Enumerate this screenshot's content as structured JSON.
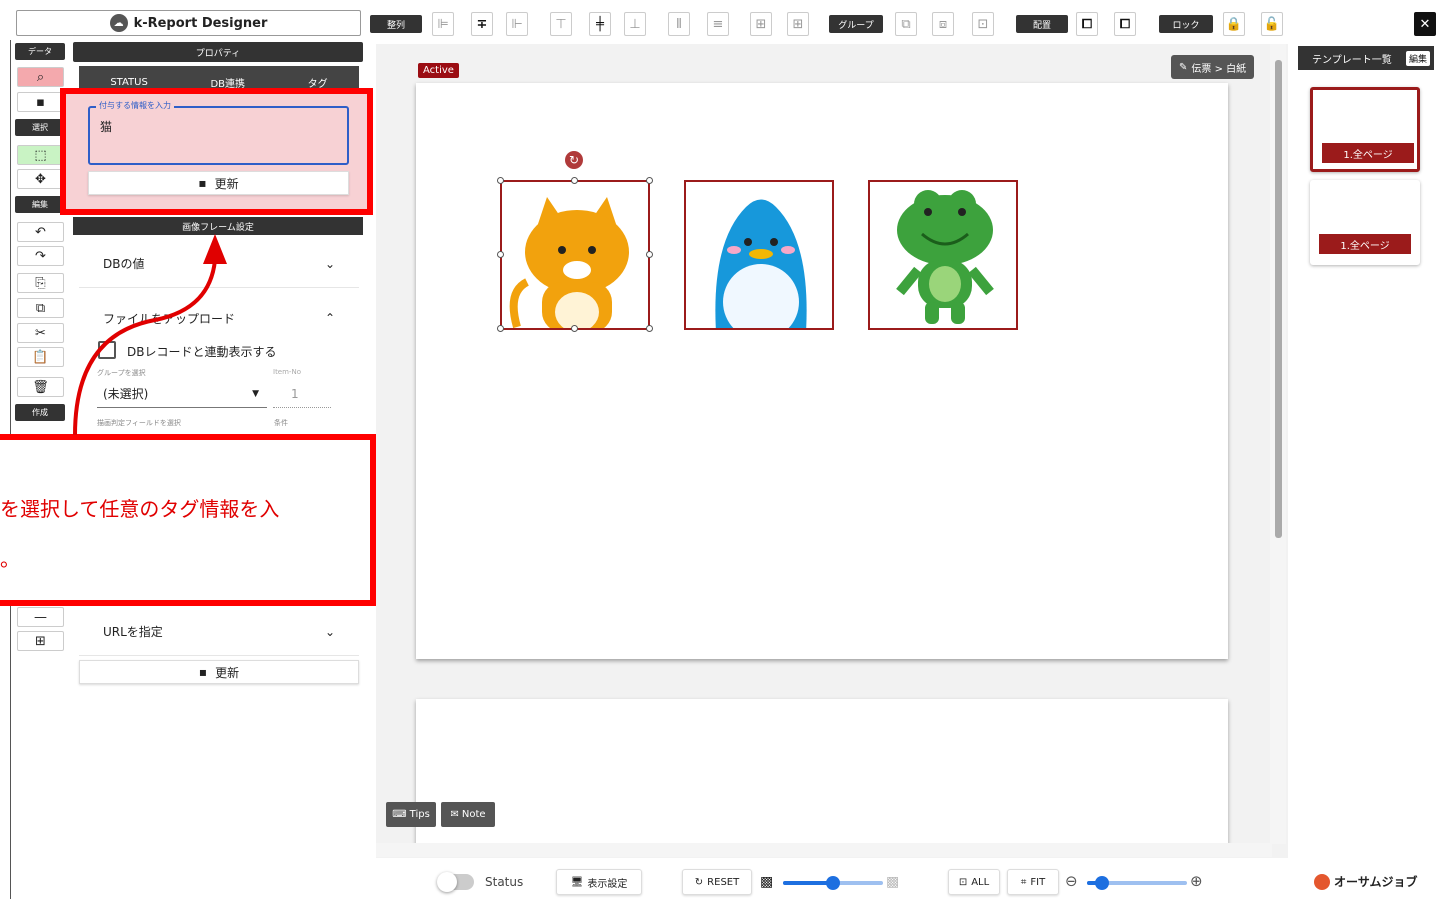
{
  "app": {
    "title": "k-Report Designer",
    "logo_icon": "cloud-icon"
  },
  "toolbar": {
    "align_label": "整列",
    "group_label": "グループ",
    "arrange_label": "配置",
    "lock_label": "ロック"
  },
  "left_sidebar": {
    "data_label": "データ",
    "select_label": "選択",
    "edit_label": "編集",
    "create_label": "作成"
  },
  "properties": {
    "title": "プロパティ",
    "tabs": [
      "STATUS",
      "DB連携",
      "タグ"
    ],
    "tag_field_label": "付与する情報を入力",
    "tag_value": "猫",
    "update_label": "更新",
    "frame_section_title": "画像フレーム設定",
    "db_value_label": "DBの値",
    "upload_label": "ファイルをアップロード",
    "link_checkbox_label": "DBレコードと連動表示する",
    "group_select_caption": "グループを選択",
    "group_select_value": "(未選択)",
    "item_no_caption": "Item-No",
    "item_no_value": "1",
    "field_caption": "描画判定フィールドを選択",
    "condition_caption": "条件",
    "url_label": "URLを指定"
  },
  "callout": {
    "line1": "を選択して任意のタグ情報を入",
    "line2": "。"
  },
  "canvas": {
    "active_badge": "Active",
    "breadcrumb": "伝票 > 白紙",
    "images": [
      "cat",
      "penguin",
      "frog"
    ]
  },
  "templates": {
    "title": "テンプレート一覧",
    "edit_label": "編集",
    "items": [
      "1.全ページ",
      "1.全ページ"
    ]
  },
  "bottom_bar": {
    "status_label": "Status",
    "display_settings_label": "表示設定",
    "reset_label": "RESET",
    "all_label": "ALL",
    "fit_label": "FIT",
    "opacity_level": 0.5,
    "zoom_level": 0.15
  },
  "brand": {
    "name": "オーサムジョブ"
  },
  "colors": {
    "accent": "#9b1b1b",
    "highlight": "#ff0000",
    "callout_text": "#e00000",
    "focus": "#2f5ec8"
  }
}
